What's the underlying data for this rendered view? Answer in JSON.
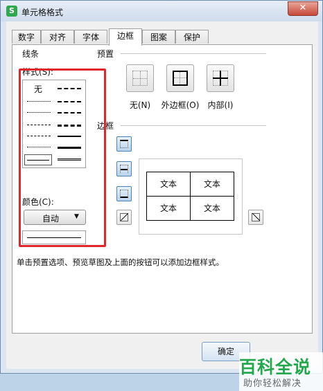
{
  "window": {
    "title": "单元格格式",
    "app_icon_letter": "S",
    "close_glyph": "✕"
  },
  "tabs": [
    {
      "label": "数字",
      "active": false
    },
    {
      "label": "对齐",
      "active": false
    },
    {
      "label": "字体",
      "active": false
    },
    {
      "label": "边框",
      "active": true
    },
    {
      "label": "图案",
      "active": false
    },
    {
      "label": "保护",
      "active": false
    }
  ],
  "line_group": {
    "title": "线条",
    "style_label": "样式(S):",
    "none_label": "无",
    "color_label": "颜色(C):",
    "color_value": "自动",
    "color_arrow": "▼"
  },
  "presets": {
    "title": "预置",
    "items": [
      {
        "label": "无(N)",
        "icon": "no-border-icon"
      },
      {
        "label": "外边框(O)",
        "icon": "outline-border-icon"
      },
      {
        "label": "内部(I)",
        "icon": "inside-border-icon"
      }
    ]
  },
  "border": {
    "title": "边框",
    "preview_cells": [
      "文本",
      "文本",
      "文本",
      "文本"
    ]
  },
  "hint": "单击预置选项、预览草图及上面的按钮可以添加边框样式。",
  "buttons": {
    "ok": "确定"
  },
  "watermark": {
    "logo": "百科全说",
    "subtitle": "助你轻松解决"
  },
  "colors": {
    "highlight": "#e0262a",
    "brand_green": "#23a84e"
  }
}
